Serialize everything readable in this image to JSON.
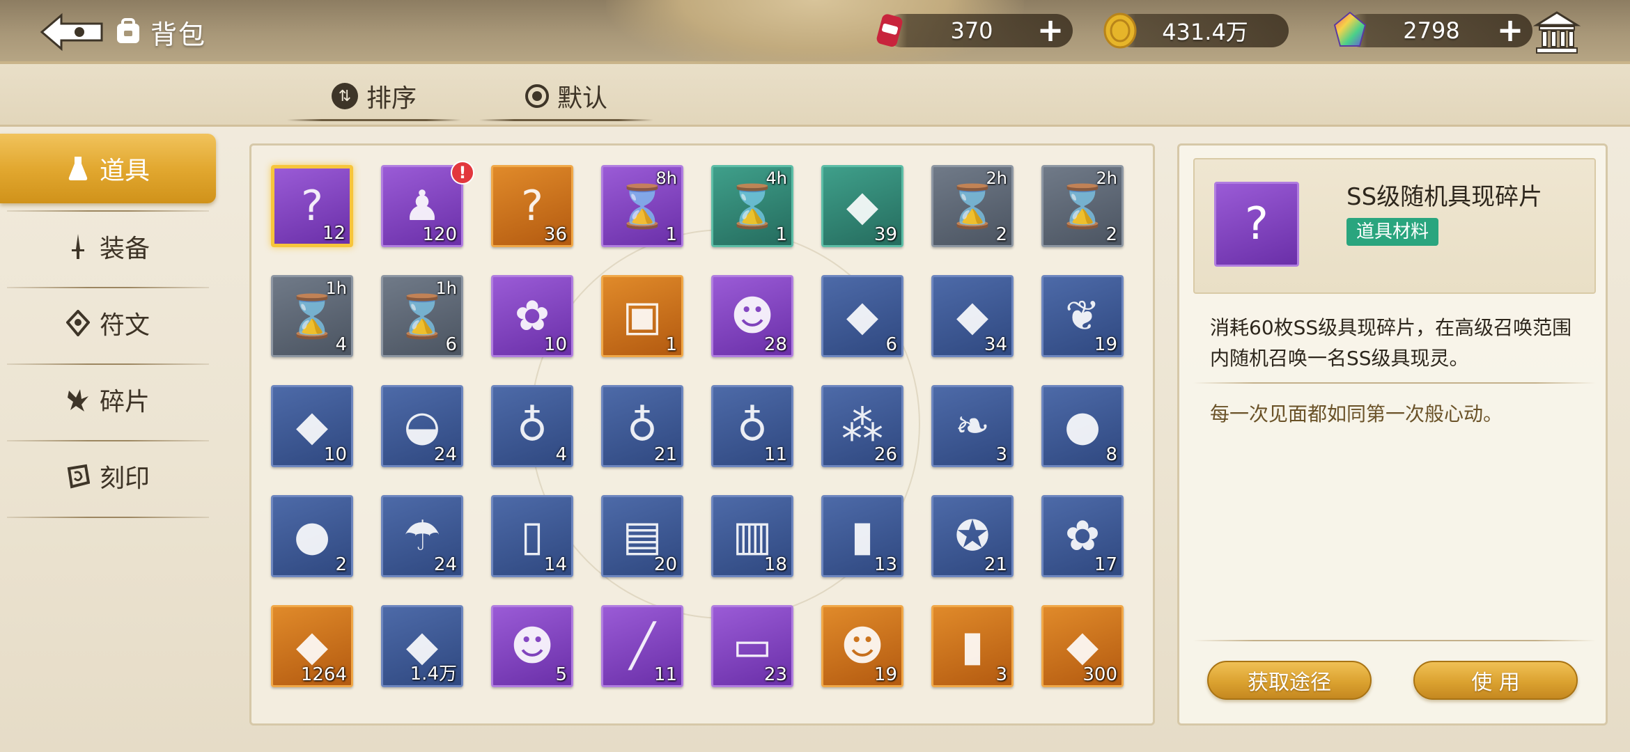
{
  "header": {
    "title": "背包",
    "currencies": [
      {
        "name": "energy-can",
        "value": "370",
        "has_plus": true,
        "color": "#c8243c"
      },
      {
        "name": "gold-coin",
        "value": "431.4万",
        "has_plus": false,
        "color": "#e6b52a"
      },
      {
        "name": "rainbow-gem",
        "value": "2798",
        "has_plus": true,
        "color": "#9a4fd6"
      }
    ],
    "plus_label": "+"
  },
  "sort": {
    "sort_label": "排序",
    "default_label": "默认"
  },
  "categories": [
    {
      "label": "道具",
      "icon": "flask-icon",
      "active": true
    },
    {
      "label": "装备",
      "icon": "sword-icon",
      "active": false
    },
    {
      "label": "符文",
      "icon": "rune-icon",
      "active": false
    },
    {
      "label": "碎片",
      "icon": "shard-icon",
      "active": false
    },
    {
      "label": "刻印",
      "icon": "seal-icon",
      "active": false
    }
  ],
  "items": [
    {
      "count": "12",
      "rarity": "purple",
      "glyph": "?",
      "selected": true
    },
    {
      "count": "120",
      "rarity": "purple",
      "glyph": "♟",
      "alert": true
    },
    {
      "count": "36",
      "rarity": "orange",
      "glyph": "?"
    },
    {
      "count": "1",
      "rarity": "purple",
      "glyph": "⌛",
      "timer": "8h"
    },
    {
      "count": "1",
      "rarity": "green",
      "glyph": "⌛",
      "timer": "4h"
    },
    {
      "count": "39",
      "rarity": "green",
      "glyph": "◆"
    },
    {
      "count": "2",
      "rarity": "gray",
      "glyph": "⌛",
      "timer": "2h"
    },
    {
      "count": "2",
      "rarity": "gray",
      "glyph": "⌛",
      "timer": "2h"
    },
    {
      "count": "4",
      "rarity": "gray",
      "glyph": "⌛",
      "timer": "1h"
    },
    {
      "count": "6",
      "rarity": "gray",
      "glyph": "⌛",
      "timer": "1h"
    },
    {
      "count": "10",
      "rarity": "purple",
      "glyph": "✿"
    },
    {
      "count": "1",
      "rarity": "orange",
      "glyph": "▣"
    },
    {
      "count": "28",
      "rarity": "purple",
      "glyph": "☻"
    },
    {
      "count": "6",
      "rarity": "blue",
      "glyph": "◆"
    },
    {
      "count": "34",
      "rarity": "blue",
      "glyph": "◆"
    },
    {
      "count": "19",
      "rarity": "blue",
      "glyph": "❦"
    },
    {
      "count": "10",
      "rarity": "blue",
      "glyph": "◆"
    },
    {
      "count": "24",
      "rarity": "blue",
      "glyph": "◒"
    },
    {
      "count": "4",
      "rarity": "blue",
      "glyph": "♁"
    },
    {
      "count": "21",
      "rarity": "blue",
      "glyph": "♁"
    },
    {
      "count": "11",
      "rarity": "blue",
      "glyph": "♁"
    },
    {
      "count": "26",
      "rarity": "blue",
      "glyph": "⁂"
    },
    {
      "count": "3",
      "rarity": "blue",
      "glyph": "❧"
    },
    {
      "count": "8",
      "rarity": "blue",
      "glyph": "●"
    },
    {
      "count": "2",
      "rarity": "blue",
      "glyph": "●"
    },
    {
      "count": "24",
      "rarity": "blue",
      "glyph": "☂"
    },
    {
      "count": "14",
      "rarity": "blue",
      "glyph": "▯"
    },
    {
      "count": "20",
      "rarity": "blue",
      "glyph": "▤"
    },
    {
      "count": "18",
      "rarity": "blue",
      "glyph": "▥"
    },
    {
      "count": "13",
      "rarity": "blue",
      "glyph": "▮"
    },
    {
      "count": "21",
      "rarity": "blue",
      "glyph": "✪"
    },
    {
      "count": "17",
      "rarity": "blue",
      "glyph": "✿"
    },
    {
      "count": "1264",
      "rarity": "orange",
      "glyph": "◆"
    },
    {
      "count": "1.4万",
      "rarity": "blue",
      "glyph": "◆"
    },
    {
      "count": "5",
      "rarity": "purple",
      "glyph": "☻"
    },
    {
      "count": "11",
      "rarity": "purple",
      "glyph": "╱"
    },
    {
      "count": "23",
      "rarity": "purple",
      "glyph": "▭"
    },
    {
      "count": "19",
      "rarity": "orange",
      "glyph": "☻"
    },
    {
      "count": "3",
      "rarity": "orange",
      "glyph": "▮"
    },
    {
      "count": "300",
      "rarity": "orange",
      "glyph": "◆"
    }
  ],
  "detail": {
    "name": "SS级随机具现碎片",
    "tag": "道具材料",
    "description": "消耗60枚SS级具现碎片，在高级召唤范围内随机召唤一名SS级具现灵。",
    "flavor": "每一次见面都如同第一次般心动。",
    "btn_source": "获取途径",
    "btn_use": "使 用",
    "thumb_glyph": "?"
  }
}
